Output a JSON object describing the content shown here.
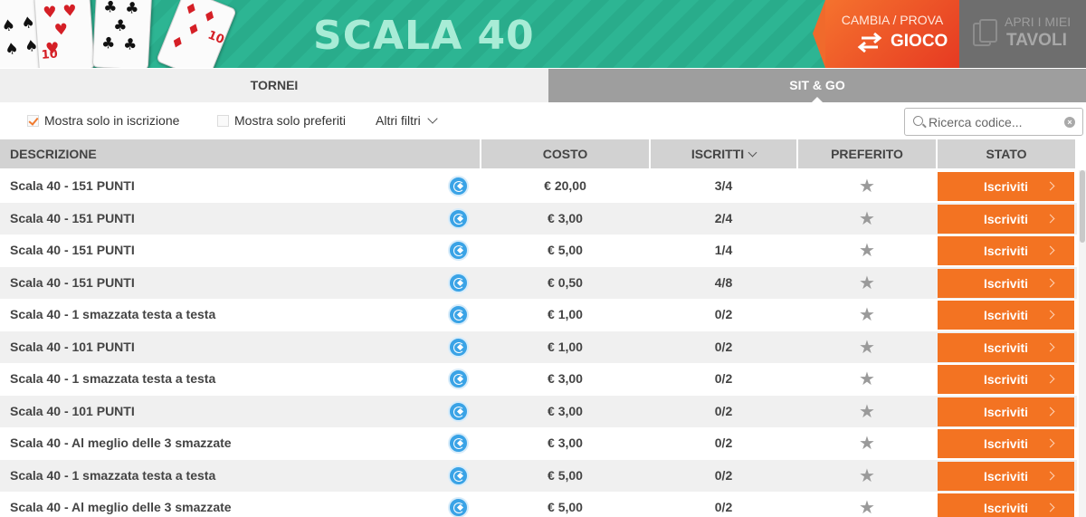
{
  "banner": {
    "title": "SCALA 40",
    "switch_top": "CAMBIA / PROVA",
    "switch_bottom": "GIOCO",
    "tables_top": "APRI I MIEI",
    "tables_bottom": "TAVOLI"
  },
  "tabs": [
    {
      "label": "TORNEI",
      "active": false
    },
    {
      "label": "SIT & GO",
      "active": true
    }
  ],
  "filters": {
    "only_enrolling": {
      "label": "Mostra solo in iscrizione",
      "checked": true
    },
    "only_favorites": {
      "label": "Mostra solo preferiti",
      "checked": false
    },
    "more_label": "Altri filtri",
    "search_placeholder": "Ricerca codice..."
  },
  "table": {
    "headers": {
      "description": "DESCRIZIONE",
      "cost": "COSTO",
      "enrolled": "ISCRITTI",
      "favorite": "PREFERITO",
      "status": "STATO"
    },
    "rows": [
      {
        "description": "Scala 40 - 151 PUNTI",
        "cost": "€ 20,00",
        "enrolled": "3/4",
        "status": "Iscriviti"
      },
      {
        "description": "Scala 40 - 151 PUNTI",
        "cost": "€ 3,00",
        "enrolled": "2/4",
        "status": "Iscriviti"
      },
      {
        "description": "Scala 40 - 151 PUNTI",
        "cost": "€ 5,00",
        "enrolled": "1/4",
        "status": "Iscriviti"
      },
      {
        "description": "Scala 40 - 151 PUNTI",
        "cost": "€ 0,50",
        "enrolled": "4/8",
        "status": "Iscriviti"
      },
      {
        "description": "Scala 40 - 1 smazzata testa a testa",
        "cost": "€ 1,00",
        "enrolled": "0/2",
        "status": "Iscriviti"
      },
      {
        "description": "Scala 40 - 101 PUNTI",
        "cost": "€ 1,00",
        "enrolled": "0/2",
        "status": "Iscriviti"
      },
      {
        "description": "Scala 40 - 1 smazzata testa a testa",
        "cost": "€ 3,00",
        "enrolled": "0/2",
        "status": "Iscriviti"
      },
      {
        "description": "Scala 40 - 101 PUNTI",
        "cost": "€ 3,00",
        "enrolled": "0/2",
        "status": "Iscriviti"
      },
      {
        "description": "Scala 40 - Al meglio delle 3 smazzate",
        "cost": "€ 3,00",
        "enrolled": "0/2",
        "status": "Iscriviti"
      },
      {
        "description": "Scala 40 - 1 smazzata testa a testa",
        "cost": "€ 5,00",
        "enrolled": "0/2",
        "status": "Iscriviti"
      },
      {
        "description": "Scala 40 - Al meglio delle 3 smazzate",
        "cost": "€ 5,00",
        "enrolled": "0/2",
        "status": "Iscriviti"
      }
    ]
  },
  "icons": {
    "favorite": "star-icon",
    "badge": "game-mode-icon",
    "search": "search-icon",
    "clear": "clear-icon"
  },
  "colors": {
    "banner_green": "#2db593",
    "switch_orange": "#f37322",
    "status_button": "#f37322",
    "badge_blue": "#3aa3e6",
    "active_tab": "#9e9e9e",
    "tables_grey": "#6e6e6e"
  }
}
